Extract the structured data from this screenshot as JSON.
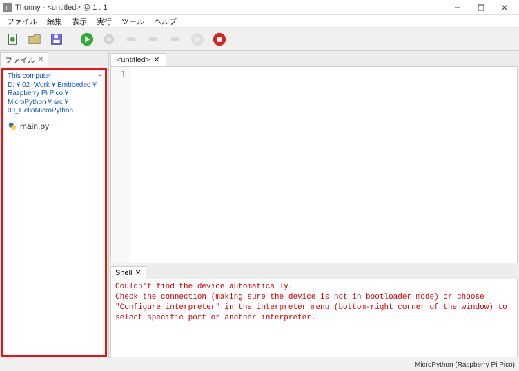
{
  "title": "Thonny  -  <untitled>  @  1 : 1",
  "menu": {
    "file": "ファイル",
    "edit": "編集",
    "view": "表示",
    "run": "実行",
    "tools": "ツール",
    "help": "ヘルプ"
  },
  "sidebar": {
    "tab_label": "ファイル",
    "breadcrumb": "This computer\nD: ¥ 02_Work ¥ Embbeded ¥\nRaspberry Pi Pico ¥\nMicroPython ¥ src ¥\n00_HelloMicroPython",
    "file": "main.py"
  },
  "editor": {
    "tab_label": "<untitled>",
    "line_number": "1",
    "content": ""
  },
  "shell": {
    "tab_label": "Shell",
    "text": "Couldn't find the device automatically.\nCheck the connection (making sure the device is not in bootloader mode) or choose \"Configure interpreter\" in the interpreter menu (bottom-right corner of the window) to select specific port or another interpreter."
  },
  "status": {
    "interpreter": "MicroPython (Raspberry Pi Pico)"
  }
}
